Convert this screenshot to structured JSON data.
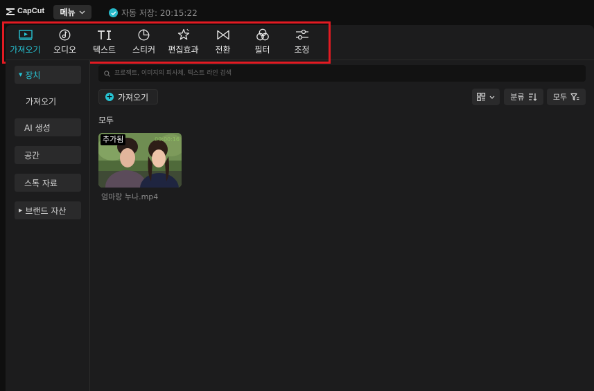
{
  "app": {
    "logo_text": "CapCut",
    "menu_label": "메뉴",
    "autosave_text": "자동 저장: 20:15:22",
    "accent_color": "#27c3d3",
    "highlight_color": "#e31a22"
  },
  "tabs": [
    {
      "label": "가져오기",
      "icon": "media-play-icon",
      "active": true
    },
    {
      "label": "오디오",
      "icon": "audio-note-icon",
      "active": false
    },
    {
      "label": "텍스트",
      "icon": "text-ti-icon",
      "active": false
    },
    {
      "label": "스티커",
      "icon": "sticker-icon",
      "active": false
    },
    {
      "label": "편집효과",
      "icon": "effects-star-icon",
      "active": false
    },
    {
      "label": "전환",
      "icon": "transition-bowtie-icon",
      "active": false
    },
    {
      "label": "필터",
      "icon": "filter-circles-icon",
      "active": false
    },
    {
      "label": "조정",
      "icon": "adjust-sliders-icon",
      "active": false
    }
  ],
  "sidebar": {
    "items": [
      {
        "label": "장치",
        "expanded": true,
        "active": true
      },
      {
        "label": "가져오기"
      },
      {
        "label": "AI 생성"
      },
      {
        "label": "공간"
      },
      {
        "label": "스톡 자료"
      },
      {
        "label": "브랜드 자산",
        "expanded": false
      }
    ]
  },
  "search": {
    "placeholder": "프로젝트, 이미지의 피사체, 텍스트 라인 검색",
    "value": ""
  },
  "toolbar": {
    "import_label": "가져오기",
    "sort_label": "분류",
    "filter_label": "모두"
  },
  "section_title": "모두",
  "media": [
    {
      "badge": "추가됨",
      "filename": "엄마랑 누나.mp4",
      "duration": "00:00:16"
    }
  ]
}
